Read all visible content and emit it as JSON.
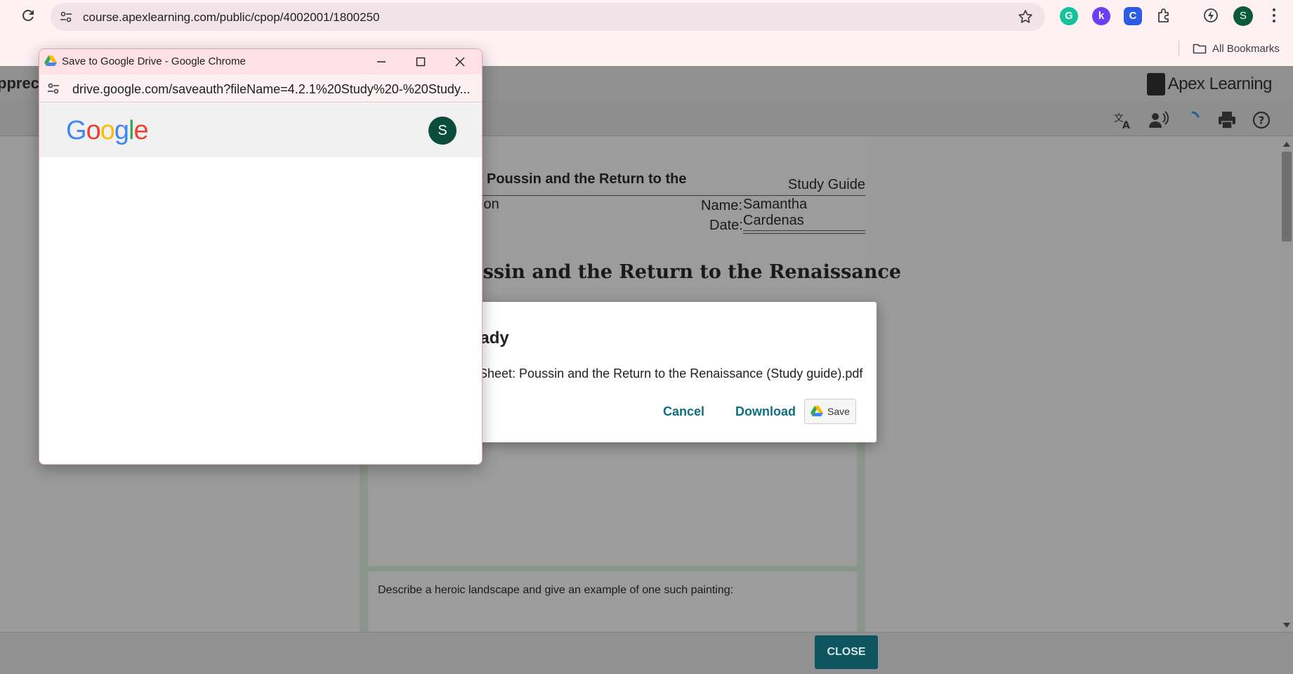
{
  "browser": {
    "url": "course.apexlearning.com/public/cpop/4002001/1800250",
    "bookmarks_label": "All Bookmarks",
    "profile_initial": "S",
    "extensions": [
      {
        "name": "grammarly-extension",
        "glyph": "G",
        "color": "#15c39a"
      },
      {
        "name": "k-extension",
        "glyph": "k",
        "color": "#6b3df5"
      },
      {
        "name": "c-extension",
        "glyph": "C",
        "color": "#2d5be3"
      }
    ]
  },
  "apex": {
    "title_partial": "ppreci",
    "logo_text": "Apex Learning",
    "close_label": "CLOSE"
  },
  "doc": {
    "heading_partial": "Poussin and the Return to the",
    "kind": "Study Guide",
    "section_partial": "ion",
    "name_label": "Name:",
    "name_value": "Samantha Cardenas",
    "date_label": "Date:",
    "lesson_title_partial": "ussin and the Return to the Renaissance",
    "prompt": "Describe a heroic landscape and give an example of one such painting:"
  },
  "ready_dialog": {
    "title_partial": "eady",
    "file_partial": "y Sheet: Poussin and the Return to the Renaissance (Study guide).pdf",
    "cancel_label": "Cancel",
    "download_label": "Download",
    "save_label": "Save"
  },
  "drive_popup": {
    "window_title": "Save to Google Drive - Google Chrome",
    "url": "drive.google.com/saveauth?fileName=4.2.1%20Study%20-%20Study...",
    "logo": [
      {
        "char": "G",
        "color": "#4285F4"
      },
      {
        "char": "o",
        "color": "#EA4335"
      },
      {
        "char": "o",
        "color": "#FBBC05"
      },
      {
        "char": "g",
        "color": "#4285F4"
      },
      {
        "char": "l",
        "color": "#34A853"
      },
      {
        "char": "e",
        "color": "#EA4335"
      }
    ],
    "avatar_initial": "S"
  }
}
